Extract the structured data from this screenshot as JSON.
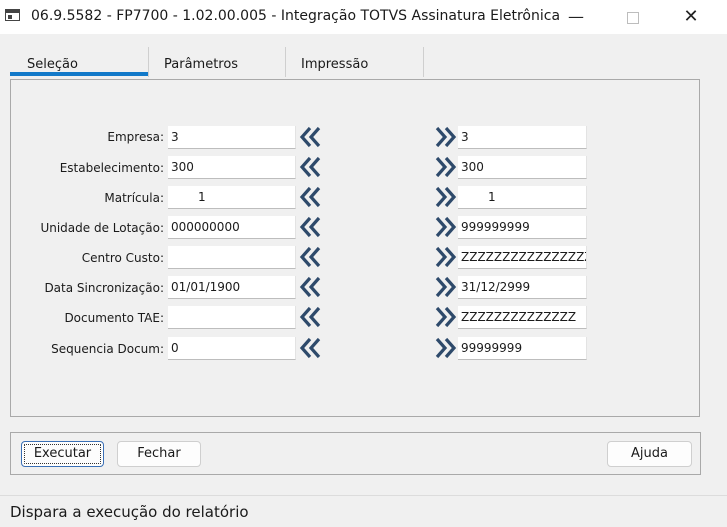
{
  "window": {
    "title": "06.9.5582 - FP7700 - 1.02.00.005 - Integração TOTVS Assinatura Eletrônica",
    "minimize_glyph": "—",
    "close_glyph": "✕"
  },
  "tabs": [
    {
      "label": "Seleção",
      "active": true
    },
    {
      "label": "Parâmetros",
      "active": false
    },
    {
      "label": "Impressão",
      "active": false
    }
  ],
  "rows": [
    {
      "label": "Empresa:",
      "from": "3",
      "to": "3"
    },
    {
      "label": "Estabelecimento:",
      "from": "300",
      "to": "300"
    },
    {
      "label": "Matrícula:",
      "from": "1",
      "to": "1"
    },
    {
      "label": "Unidade de Lotação:",
      "from": "000000000",
      "to": "999999999"
    },
    {
      "label": "Centro Custo:",
      "from": "",
      "to": "ZZZZZZZZZZZZZZZZZZZZ"
    },
    {
      "label": "Data Sincronização:",
      "from": "01/01/1900",
      "to": "31/12/2999"
    },
    {
      "label": "Documento TAE:",
      "from": "",
      "to": "ZZZZZZZZZZZZZZ"
    },
    {
      "label": "Sequencia Docum:",
      "from": "0",
      "to": "99999999"
    }
  ],
  "buttons": {
    "execute": "Executar",
    "close": "Fechar",
    "help": "Ajuda"
  },
  "status": "Dispara a execução do relatório",
  "colors": {
    "accent": "#1279c9",
    "chevron": "#2e4a6b"
  },
  "icons": {
    "left_range": "double-chevron-left-icon",
    "right_range": "double-chevron-right-icon"
  }
}
